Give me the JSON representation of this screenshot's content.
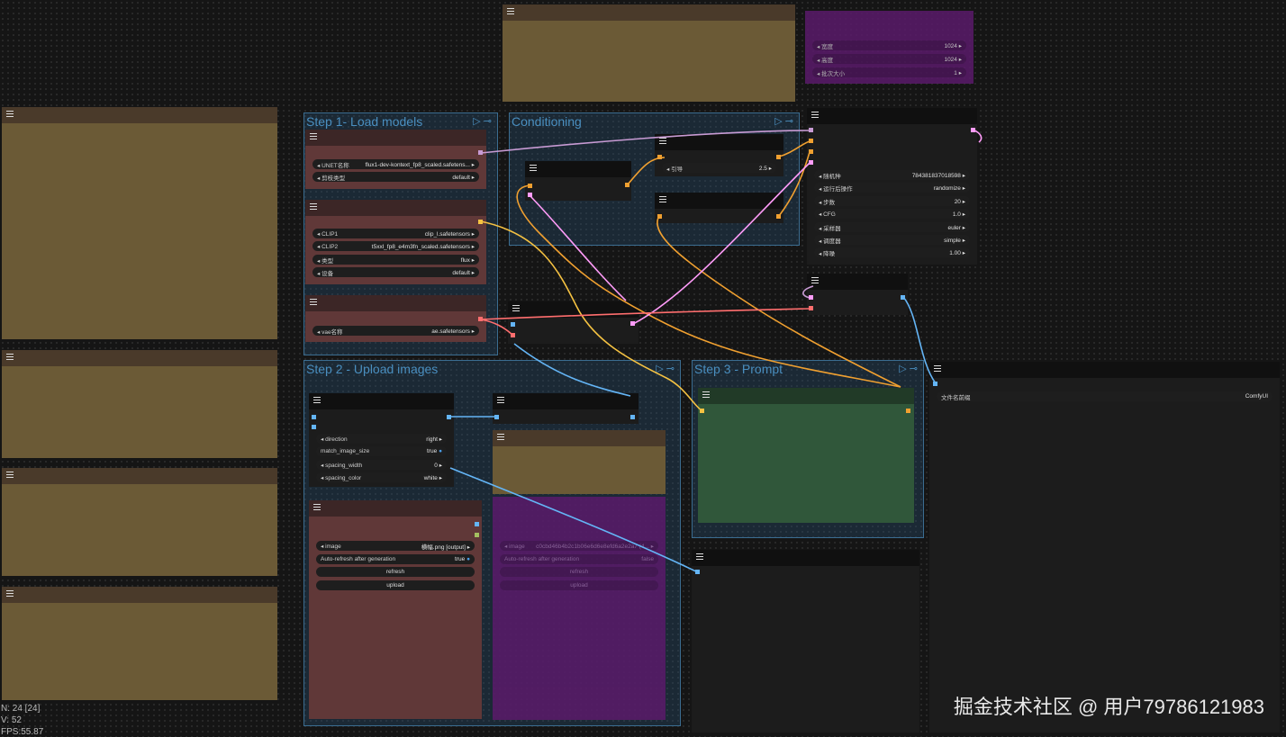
{
  "groups": {
    "step1": "Step 1- Load models",
    "conditioning": "Conditioning",
    "step2": "Step 2 - Upload images",
    "step3": "Step 3 - Prompt"
  },
  "unet": {
    "label": "UNET名称",
    "value": "flux1-dev-kontext_fp8_scaled.safetens...",
    "dtype_label": "剪枝类型",
    "dtype_value": "default"
  },
  "clip": {
    "clip1_label": "CLIP1",
    "clip1_value": "clip_l.safetensors",
    "clip2_label": "CLIP2",
    "clip2_value": "t5xxl_fp8_e4m3fn_scaled.safetensors",
    "type_label": "类型",
    "type_value": "flux",
    "device_label": "设备",
    "device_value": "default"
  },
  "vae": {
    "label": "vae名称",
    "value": "ae.safetensors"
  },
  "guidance": {
    "label": "引导",
    "value": "2.5"
  },
  "ksampler": {
    "seed_label": "随机种",
    "seed_value": "784381837018598",
    "control_label": "运行后操作",
    "control_value": "randomize",
    "steps_label": "步数",
    "steps_value": "20",
    "cfg_label": "CFG",
    "cfg_value": "1.0",
    "sampler_label": "采样器",
    "sampler_value": "euler",
    "scheduler_label": "调度器",
    "scheduler_value": "simple",
    "denoise_label": "降噪",
    "denoise_value": "1.00"
  },
  "top_purple": {
    "r1": "宽度",
    "r1v": "1024",
    "r2": "高度",
    "r2v": "1024",
    "r3": "批次大小",
    "r3v": "1"
  },
  "stitch": {
    "direction_label": "direction",
    "direction_value": "right",
    "match_label": "match_image_size",
    "match_value": "true",
    "spacing_width_label": "spacing_width",
    "spacing_width_value": "0",
    "spacing_color_label": "spacing_color",
    "spacing_color_value": "white"
  },
  "load_image": {
    "image_label": "image",
    "image_value": "横幅.png [output]",
    "auto_label": "Auto-refresh after generation",
    "auto_value": "true",
    "refresh": "refresh",
    "upload": "upload"
  },
  "purple_load": {
    "image_label": "image",
    "image_value": "c0cbd46b4b2c1b06e6d6e8efd6a2e2a7 (4...",
    "auto_label": "Auto-refresh after generation",
    "auto_value": "false",
    "refresh": "refresh",
    "upload": "upload"
  },
  "save": {
    "label": "文件名前缀",
    "value": "ComfyUI"
  },
  "stats": {
    "n": "N: 24 [24]",
    "v": "V: 52",
    "fps": "FPS:55.87"
  },
  "watermark": "掘金技术社区 @ 用户7978612198​3",
  "colors": {
    "clip_link": "#f5c242",
    "conditioning_link": "#f0a030",
    "model_link": "#c89bd4",
    "image_link": "#64b5f6",
    "vae_link": "#ff6e6e",
    "latent_link": "#ff9cf9"
  }
}
